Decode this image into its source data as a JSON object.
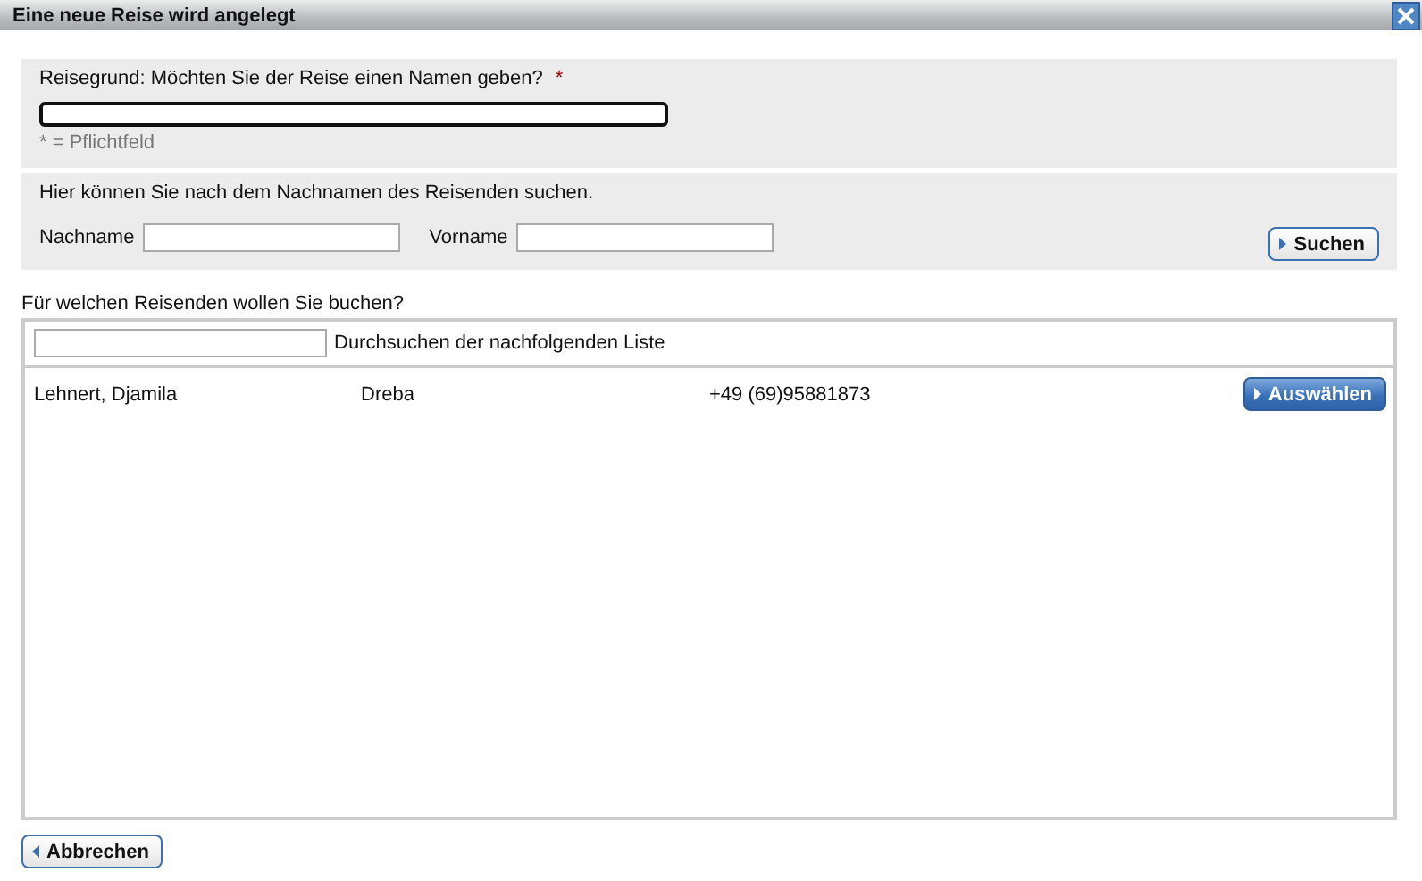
{
  "window": {
    "title": "Eine neue Reise wird angelegt"
  },
  "trip_name": {
    "label": "Reisegrund: Möchten Sie der Reise einen Namen geben?",
    "required_mark": "*",
    "hint": "* = Pflichtfeld"
  },
  "traveler_search": {
    "intro": "Hier können Sie nach dem Nachnamen des Reisenden suchen.",
    "last_name_label": "Nachname",
    "first_name_label": "Vorname",
    "button": "Suchen"
  },
  "list": {
    "question": "Für welchen Reisenden wollen Sie buchen?",
    "filter_label": "Durchsuchen der nachfolgenden Liste",
    "rows": [
      {
        "name": "Lehnert, Djamila",
        "city": "Dreba",
        "phone": "+49 (69)95881873",
        "button": "Auswählen"
      }
    ]
  },
  "cancel_button": "Abbrechen"
}
